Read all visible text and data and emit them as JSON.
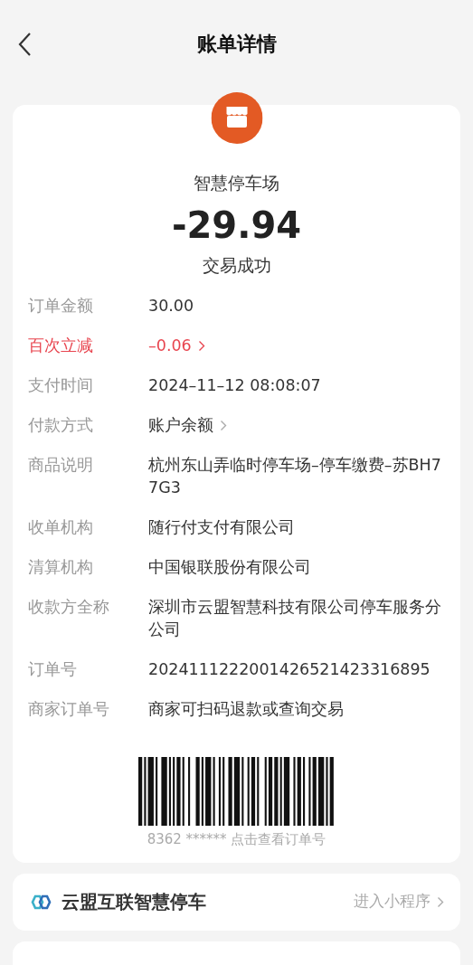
{
  "header": {
    "title": "账单详情"
  },
  "summary": {
    "merchant": "智慧停车场",
    "amount": "-29.94",
    "status": "交易成功"
  },
  "details": [
    {
      "label": "订单金额",
      "value": "30.00",
      "kind": "plain"
    },
    {
      "label": "百次立减",
      "value": "–0.06",
      "kind": "discount"
    },
    {
      "label": "支付时间",
      "value": "2024–11–12 08:08:07",
      "kind": "plain"
    },
    {
      "label": "付款方式",
      "value": "账户余额",
      "kind": "link"
    },
    {
      "label": "商品说明",
      "value": "杭州东山弄临时停车场–停车缴费–苏BH77G3",
      "kind": "plain"
    },
    {
      "label": "收单机构",
      "value": "随行付支付有限公司",
      "kind": "plain"
    },
    {
      "label": "清算机构",
      "value": "中国银联股份有限公司",
      "kind": "plain"
    },
    {
      "label": "收款方全称",
      "value": "深圳市云盟智慧科技有限公司停车服务分公司",
      "kind": "plain"
    },
    {
      "label": "订单号",
      "value": "2024111222001426521423316895",
      "kind": "plain"
    },
    {
      "label": "商家订单号",
      "value": "商家可扫码退款或查询交易",
      "kind": "plain"
    }
  ],
  "barcode": {
    "caption": "8362 ****** 点击查看订单号"
  },
  "mini_program": {
    "name": "云盟互联智慧停车",
    "action": "进入小程序"
  }
}
